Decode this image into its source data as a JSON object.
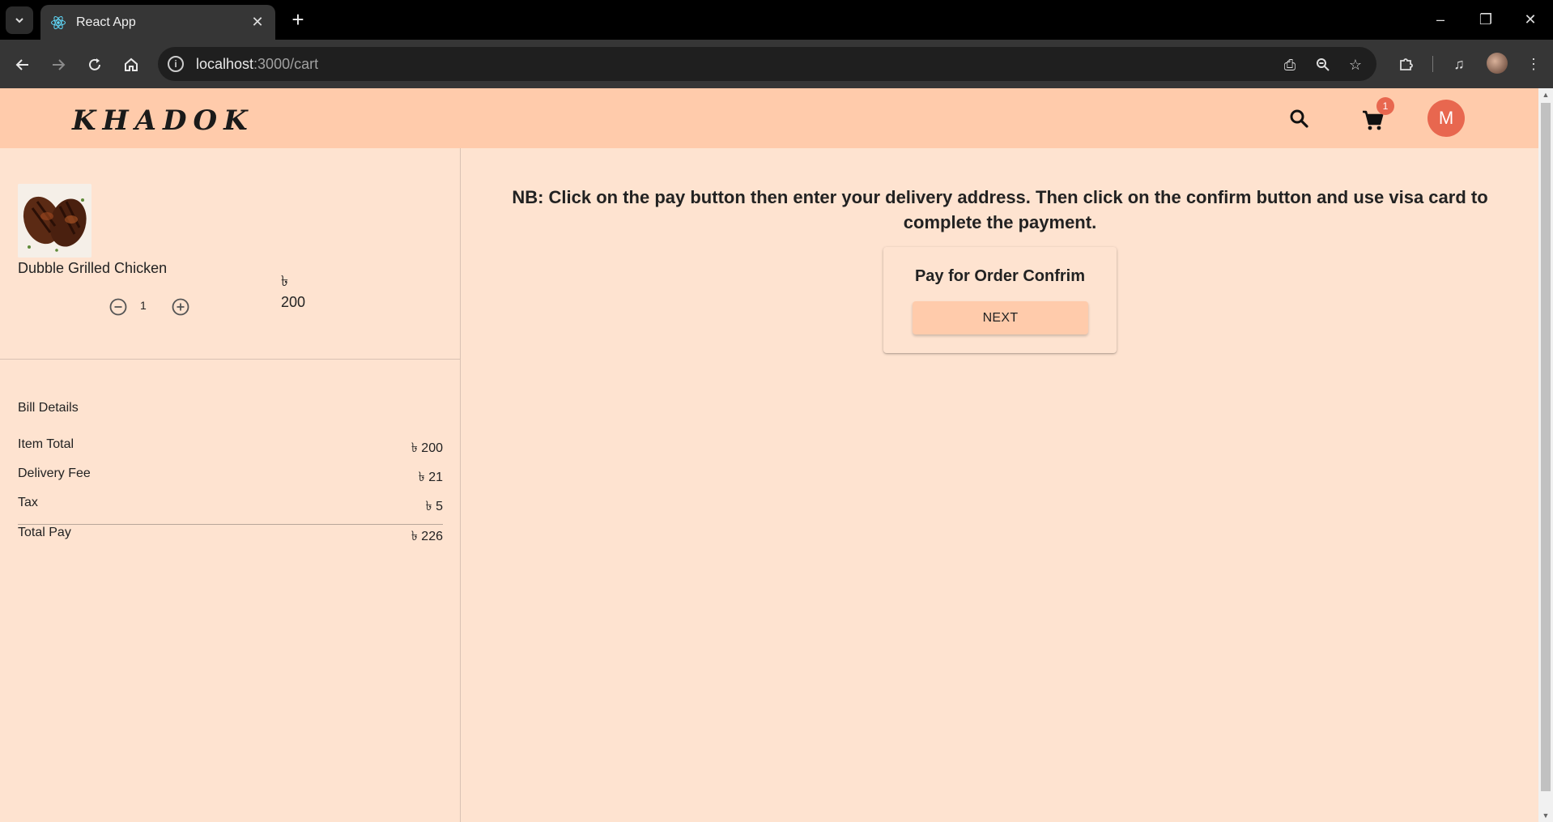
{
  "browser": {
    "tab_title": "React App",
    "url_host": "localhost",
    "url_path": ":3000/cart",
    "icons": {
      "tab_search": "chevron-down-icon",
      "favicon": "react-icon",
      "tab_close": "close-icon",
      "new_tab": "plus-icon",
      "back": "arrow-left-icon",
      "forward": "arrow-right-icon",
      "reload": "reload-icon",
      "home": "home-icon",
      "site_info": "info-icon",
      "install": "install-app-icon",
      "zoom": "zoom-out-icon",
      "bookmark": "star-icon",
      "extensions": "puzzle-icon",
      "media": "media-icon",
      "menu": "kebab-menu-icon"
    }
  },
  "header": {
    "logo": "KHADOK",
    "cart_count": "1",
    "avatar_letter": "M",
    "colors": {
      "header_bg": "#ffcbab",
      "accent": "#e8674f",
      "page_bg": "#fee3d0"
    }
  },
  "cart": {
    "items": [
      {
        "name": "Dubble Grilled Chicken",
        "quantity": "1",
        "currency": "৳",
        "price": "200"
      }
    ]
  },
  "bill": {
    "title": "Bill Details",
    "rows": [
      {
        "label": "Item Total",
        "value": "৳ 200"
      },
      {
        "label": "Delivery Fee",
        "value": "৳ 21"
      },
      {
        "label": "Tax",
        "value": "৳ 5"
      },
      {
        "label": "Total Pay",
        "value": "৳ 226"
      }
    ]
  },
  "payment": {
    "note": "NB: Click on the pay button then enter your delivery address. Then click on the confirm button and use visa card to complete the payment.",
    "card_title": "Pay for Order Confrim",
    "next_label": "NEXT"
  }
}
